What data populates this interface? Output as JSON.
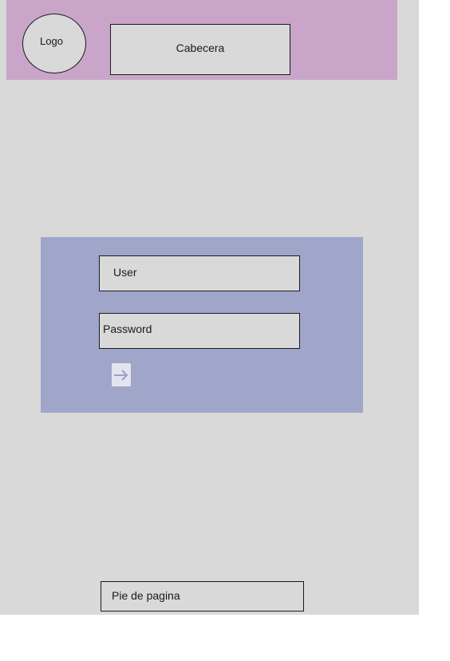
{
  "header": {
    "logo_label": "Logo",
    "title": "Cabecera",
    "background": "#c9a6c9"
  },
  "login": {
    "user_label": "User",
    "password_label": "Password",
    "submit_icon": "sign-in-arrow-icon",
    "panel_background": "#a0a6c9"
  },
  "footer": {
    "label": "Pie de pagina"
  },
  "colors": {
    "page_background": "#d9d9d9",
    "icon_color": "#9aa0c8"
  }
}
